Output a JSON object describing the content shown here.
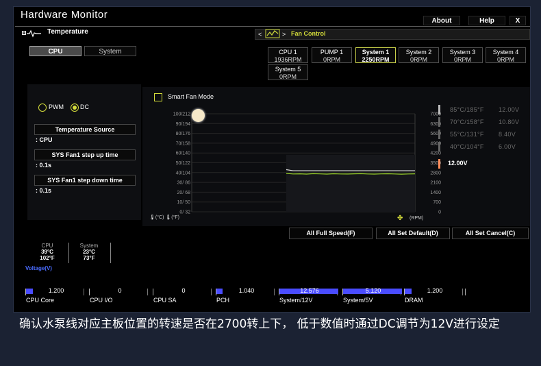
{
  "header": {
    "title": "Hardware Monitor",
    "about": "About",
    "help": "Help",
    "close": "X"
  },
  "temperature": {
    "title": "Temperature",
    "tabs": [
      "CPU",
      "System"
    ],
    "mode_pwm": "PWM",
    "mode_dc": "DC",
    "source_label": "Temperature Source",
    "source_value": ": CPU",
    "step_up_label": "SYS Fan1 step up time",
    "step_up_value": ": 0.1s",
    "step_down_label": "SYS Fan1 step down time",
    "step_down_value": ": 0.1s"
  },
  "fan_control": {
    "title": "Fan Control",
    "arrows": "<  >",
    "fans": [
      {
        "name": "CPU 1",
        "rpm": "1936RPM"
      },
      {
        "name": "PUMP 1",
        "rpm": "0RPM"
      },
      {
        "name": "System 1",
        "rpm": "2250RPM"
      },
      {
        "name": "System 2",
        "rpm": "0RPM"
      },
      {
        "name": "System 3",
        "rpm": "0RPM"
      },
      {
        "name": "System 4",
        "rpm": "0RPM"
      },
      {
        "name": "System 5",
        "rpm": "0RPM"
      }
    ],
    "smart_fan_mode": "Smart Fan Mode"
  },
  "chart_data": {
    "type": "line",
    "left_ticks": [
      "100/212",
      "90/194",
      "80/176",
      "70/158",
      "60/140",
      "50/122",
      "40/104",
      "30/ 86",
      "20/ 68",
      "10/ 50",
      "0/ 32"
    ],
    "right_ticks": [
      "7000",
      "6300",
      "5600",
      "4900",
      "4200",
      "3500",
      "2800",
      "2100",
      "1400",
      "700",
      "0"
    ],
    "left_unit_c": "(°C)",
    "left_unit_f": "(°F)",
    "right_unit": "(RPM)",
    "ylim_rpm": [
      0,
      7000
    ],
    "series": [
      {
        "color": "#9bd42a",
        "values": [
          2740,
          2700,
          2710,
          2690,
          2720,
          2705,
          2690,
          2715,
          2700,
          2695,
          2710,
          2720,
          2700,
          2690,
          2705,
          2715,
          2700,
          2685,
          2700,
          2710
        ]
      },
      {
        "color": "#d8d8d8",
        "values": [
          3010,
          2930,
          2930,
          2930,
          2930,
          2930,
          2930,
          2930,
          2930,
          2930,
          2930,
          2930,
          2930,
          2930,
          2930,
          2930,
          2930,
          2930,
          2930,
          2930
        ]
      }
    ],
    "voltage_steps": [
      {
        "temp": "85°C/185°F",
        "volt": "12.00V"
      },
      {
        "temp": "70°C/158°F",
        "volt": "10.80V"
      },
      {
        "temp": "55°C/131°F",
        "volt": "8.40V"
      },
      {
        "temp": "40°C/104°F",
        "volt": "6.00V"
      }
    ],
    "current_voltage": "12.00V"
  },
  "actions": {
    "full_speed": "All Full Speed(F)",
    "set_default": "All Set Default(D)",
    "set_cancel": "All Set Cancel(C)"
  },
  "readings": {
    "cpu_label": "CPU",
    "cpu_c": "39°C",
    "cpu_f": "102°F",
    "sys_label": "System",
    "sys_c": "23°C",
    "sys_f": "73°F",
    "voltage_title": "Voltage(V)"
  },
  "voltages": [
    {
      "name": "CPU Core",
      "value": "1.200",
      "fill": 0.12
    },
    {
      "name": "CPU I/O",
      "value": "0",
      "fill": 0
    },
    {
      "name": "CPU SA",
      "value": "0",
      "fill": 0
    },
    {
      "name": "PCH",
      "value": "1.040",
      "fill": 0.1
    },
    {
      "name": "System/12V",
      "value": "12.576",
      "fill": 1
    },
    {
      "name": "System/5V",
      "value": "5.120",
      "fill": 1
    },
    {
      "name": "DRAM",
      "value": "1.200",
      "fill": 0.12
    }
  ],
  "caption": "确认水泵线对应主板位置的转速是否在2700转上下， 低于数值时通过DC调节为12V进行设定"
}
